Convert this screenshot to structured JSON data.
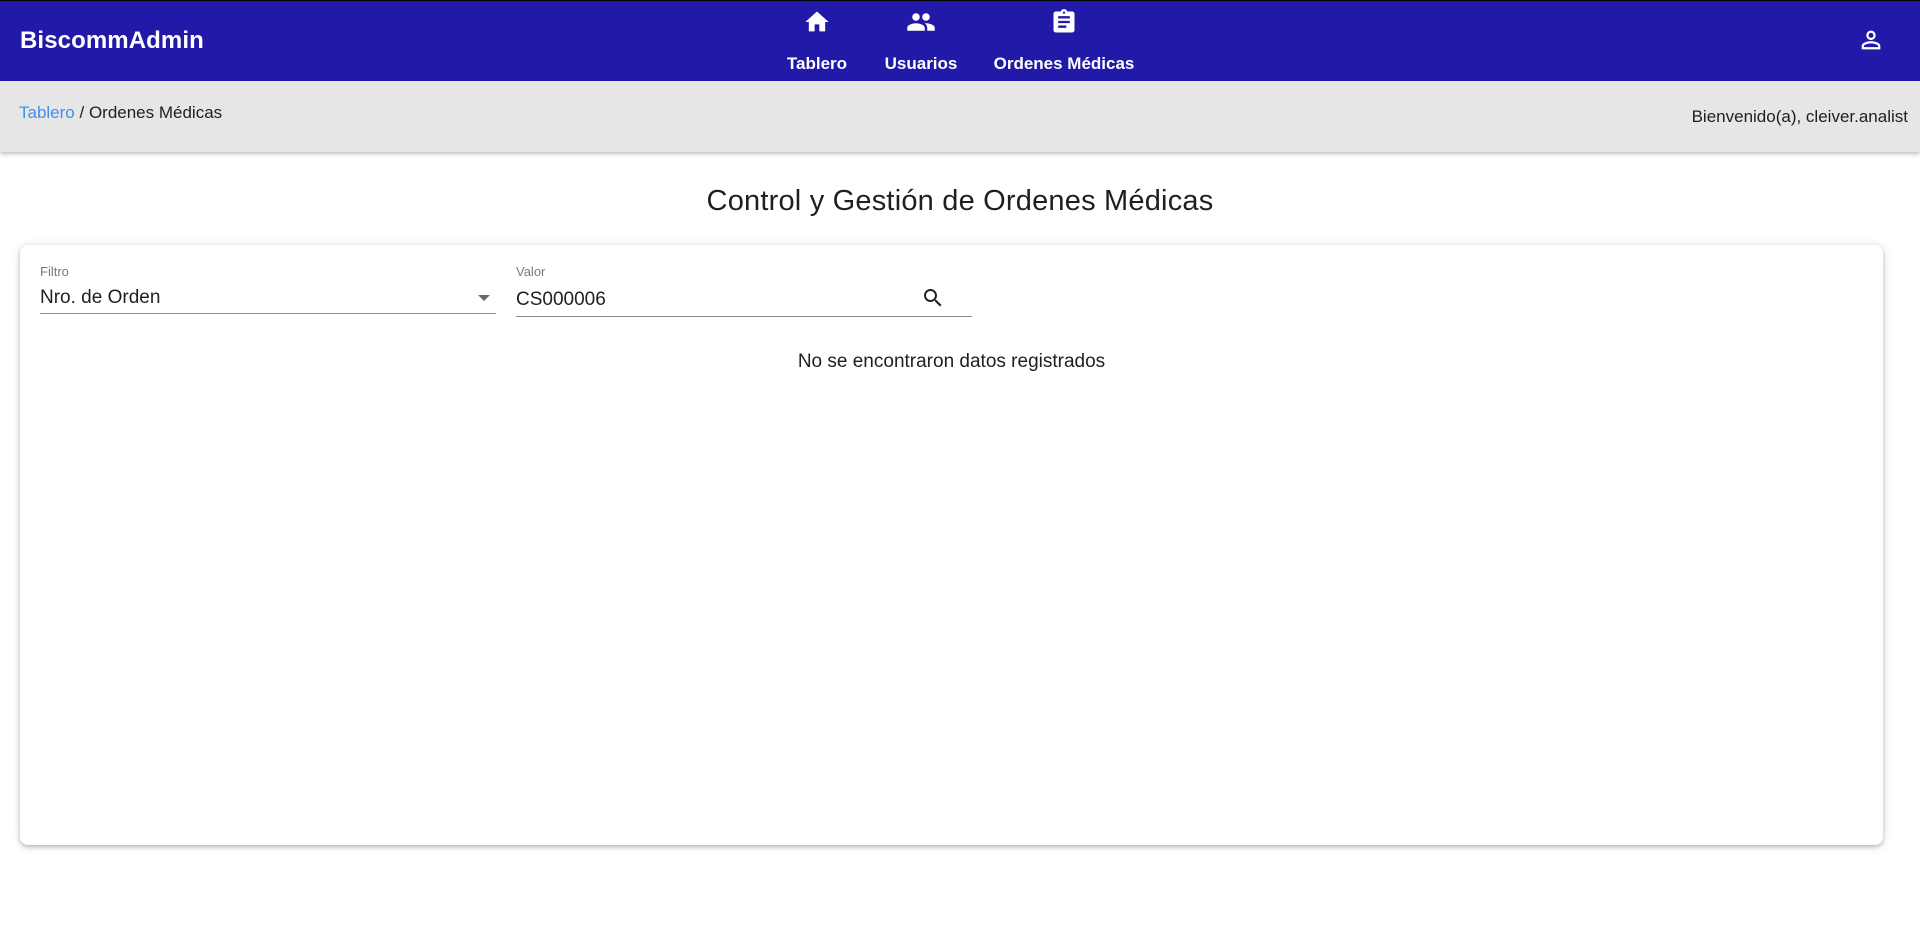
{
  "app": {
    "brand": "BiscommAdmin"
  },
  "nav": {
    "items": [
      {
        "label": "Tablero",
        "icon": "home-icon"
      },
      {
        "label": "Usuarios",
        "icon": "people-icon"
      },
      {
        "label": "Ordenes Médicas",
        "icon": "clipboard-icon"
      }
    ],
    "account_icon": "account-icon"
  },
  "colors": {
    "topbar": "#2219a8",
    "subbar": "#e6e6e6",
    "link": "#3d8ef0"
  },
  "breadcrumb": {
    "link": "Tablero",
    "separator": " / ",
    "current": "Ordenes Médicas"
  },
  "welcome": "Bienvenido(a), cleiver.analist",
  "page_title": "Control y Gestión de Ordenes Médicas",
  "filter": {
    "label": "Filtro",
    "value": "Nro. de Orden"
  },
  "search": {
    "label": "Valor",
    "value": "CS000006"
  },
  "empty_message": "No se encontraron datos registrados"
}
